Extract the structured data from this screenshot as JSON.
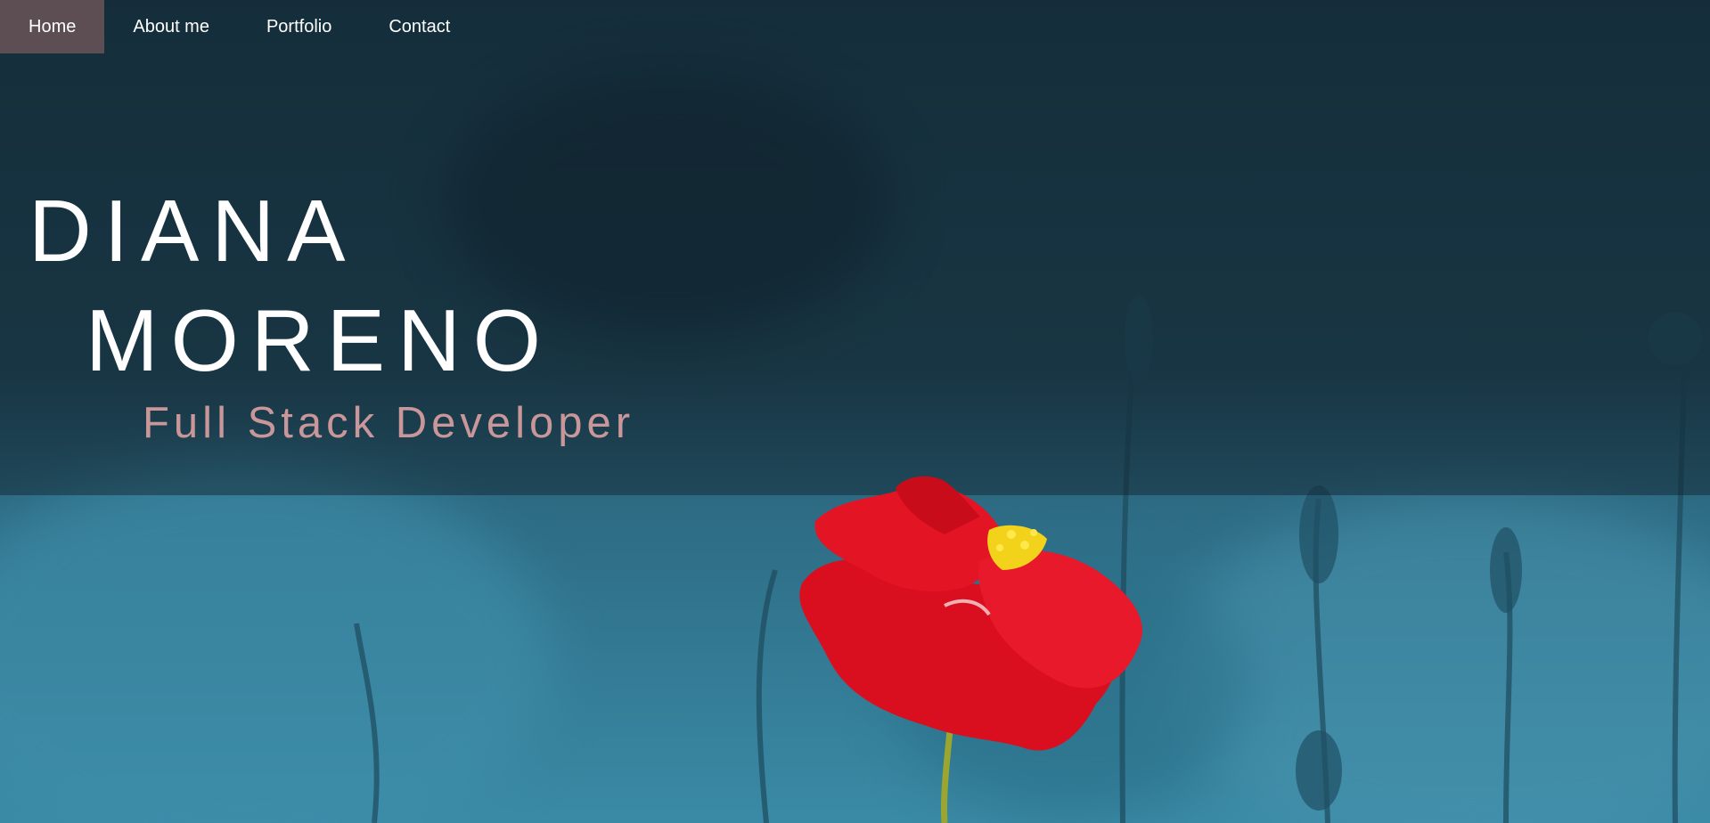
{
  "nav": {
    "items": [
      {
        "label": "Home",
        "active": true
      },
      {
        "label": "About me",
        "active": false
      },
      {
        "label": "Portfolio",
        "active": false
      },
      {
        "label": "Contact",
        "active": false
      }
    ]
  },
  "hero": {
    "first_name": "DIANA",
    "last_name": "MORENO",
    "tagline": "Full Stack Developer"
  },
  "colors": {
    "accent": "#c9969a",
    "active_nav_bg": "#8c6464",
    "flower_red": "#e01020",
    "background_teal": "#2d6a82"
  }
}
